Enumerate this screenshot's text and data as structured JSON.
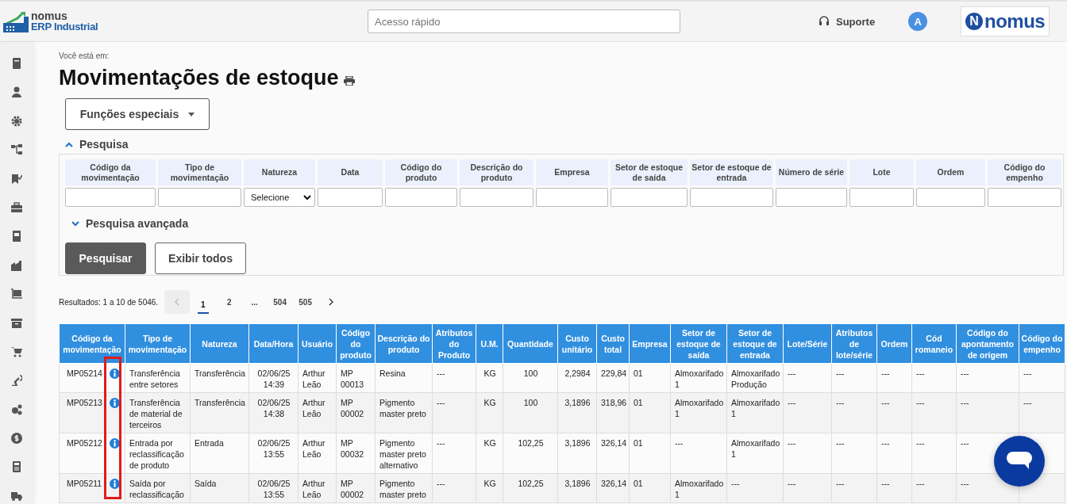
{
  "top_bar": {
    "logo": {
      "name": "nomus",
      "product": "ERP Industrial"
    },
    "search": {
      "placeholder": "Acesso rápido"
    },
    "support_label": "Suporte",
    "avatar_letter": "A",
    "brand": {
      "mark": "N",
      "name": "nomus"
    }
  },
  "breadcrumb": "Você está em:",
  "title": "Movimentações de estoque",
  "special_functions": "Funções especiais",
  "search_section": {
    "title": "Pesquisa",
    "expanded": true,
    "fields": [
      {
        "label": "Código da movimentação",
        "kind": "text"
      },
      {
        "label": "Tipo de movimentação",
        "kind": "text"
      },
      {
        "label": "Natureza",
        "kind": "select",
        "value": "Selecione"
      },
      {
        "label": "Data",
        "kind": "text"
      },
      {
        "label": "Código do produto",
        "kind": "text"
      },
      {
        "label": "Descrição do produto",
        "kind": "text"
      },
      {
        "label": "Empresa",
        "kind": "text"
      },
      {
        "label": "Setor de estoque de saída",
        "kind": "text"
      },
      {
        "label": "Setor de estoque de entrada",
        "kind": "text"
      },
      {
        "label": "Número de série",
        "kind": "text"
      },
      {
        "label": "Lote",
        "kind": "text"
      },
      {
        "label": "Ordem",
        "kind": "text"
      },
      {
        "label": "Código do empenho",
        "kind": "text"
      }
    ],
    "advanced": {
      "label": "Pesquisa avançada",
      "expanded": false
    },
    "buttons": [
      {
        "label": "Pesquisar",
        "kind": "primary"
      },
      {
        "label": "Exibir todos",
        "kind": "secondary"
      }
    ]
  },
  "pagination": {
    "summary": "Resultados: 1 a 10 de 5046.",
    "previous_disabled": true,
    "pages": [
      {
        "label": "1",
        "selected": true
      },
      {
        "label": "2",
        "selected": false
      },
      {
        "label": "...",
        "selected": false
      },
      {
        "label": "504",
        "selected": false
      },
      {
        "label": "505",
        "selected": false
      }
    ]
  },
  "table": {
    "columns": [
      "Código da movimentação",
      "Tipo de movimentação",
      "Natureza",
      "Data/Hora",
      "Usuário",
      "Código do produto",
      "Descrição do produto",
      "Atributos do Produto",
      "U.M.",
      "Quantidade",
      "Custo unitário",
      "Custo total",
      "Empresa",
      "Setor de estoque de saída",
      "Setor de estoque de entrada",
      "Lote/Série",
      "Atributos de lote/série",
      "Ordem",
      "Cód romaneio",
      "Código do apontamento de origem",
      "Código do empenho"
    ],
    "rows": [
      {
        "cells": [
          "MP05214",
          "Transferência entre setores",
          "Transferência",
          "02/06/25 14:39",
          "Arthur Leão",
          "MP 00013",
          "Resina",
          "---",
          "KG",
          "100",
          "2,2984",
          "229,84",
          "01",
          "Almoxarifado 1",
          "Almoxarifado Produção",
          "---",
          "---",
          "---",
          "---",
          "---",
          "---"
        ]
      },
      {
        "cells": [
          "MP05213",
          "Transferência de material de terceiros",
          "Transferência",
          "02/06/25 14:38",
          "Arthur Leão",
          "MP 00002",
          "Pigmento master preto",
          "---",
          "KG",
          "100",
          "3,1896",
          "318,96",
          "01",
          "Almoxarifado 1",
          "Almoxarifado 1",
          "---",
          "---",
          "---",
          "---",
          "---",
          "---"
        ]
      },
      {
        "cells": [
          "MP05212",
          "Entrada por reclassificação de produto",
          "Entrada",
          "02/06/25 13:55",
          "Arthur Leão",
          "MP 00032",
          "Pigmento master preto alternativo",
          "---",
          "KG",
          "102,25",
          "3,1896",
          "326,14",
          "01",
          "---",
          "Almoxarifado 1",
          "---",
          "---",
          "---",
          "---",
          "---",
          null
        ]
      },
      {
        "cells": [
          "MP05211",
          "Saída por reclassificação",
          "Saída",
          "02/06/25 13:55",
          "Arthur Leão",
          "MP 00002",
          "Pigmento master preto",
          "---",
          "KG",
          "102,25",
          "3,1896",
          "326,14",
          "01",
          "Almoxarifado 1",
          "---",
          "---",
          "---",
          "---",
          "---",
          "---",
          null
        ]
      }
    ]
  }
}
